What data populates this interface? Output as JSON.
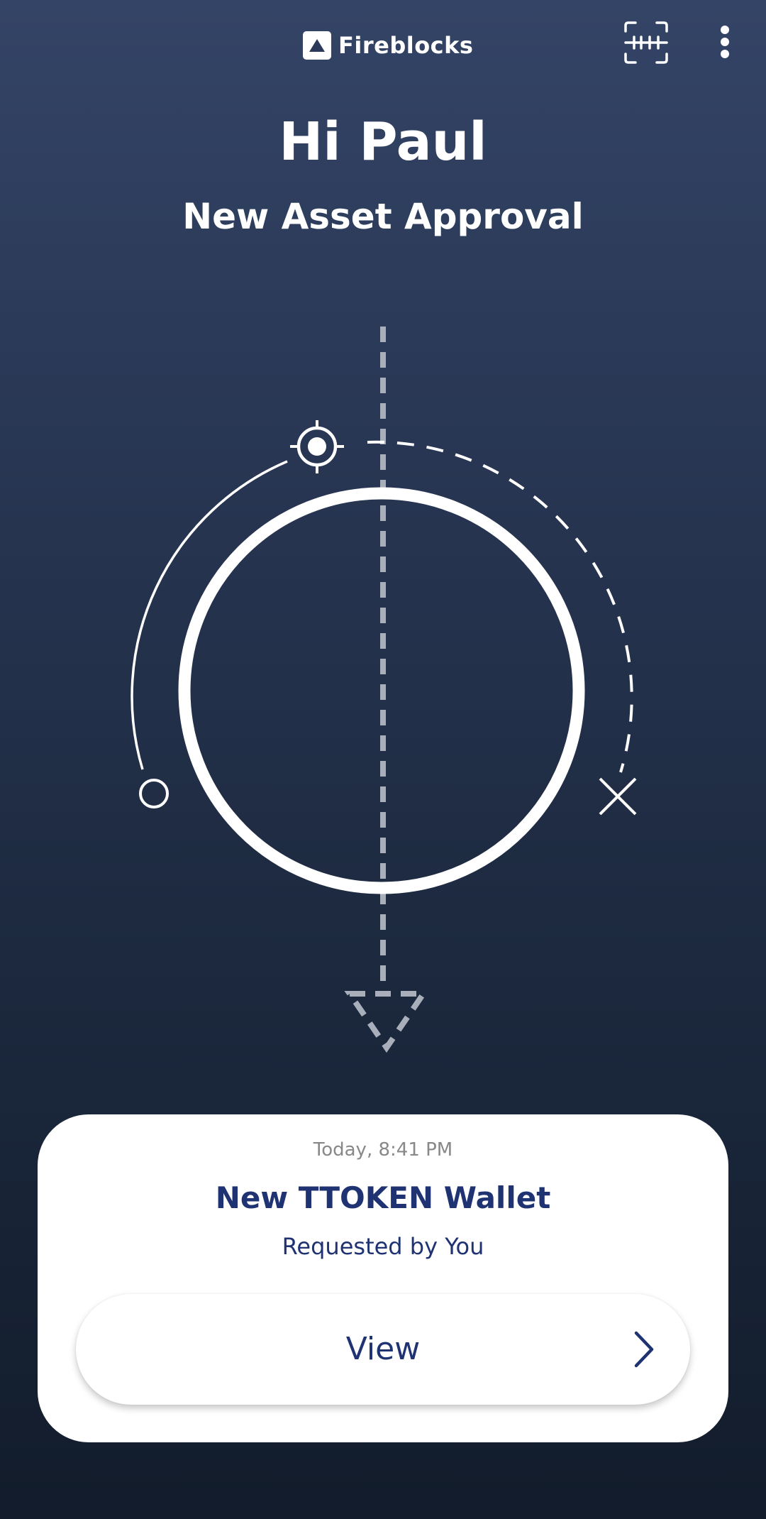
{
  "header": {
    "brand_name": "Fireblocks",
    "logo_icon": "fireblocks-logo-icon",
    "scan_icon": "qr-scan-icon",
    "menu_icon": "more-vertical-icon"
  },
  "greeting": "Hi Paul",
  "subtitle": "New Asset Approval",
  "illustration": {
    "icons": [
      "target-icon",
      "circle-icon",
      "close-x-icon",
      "triangle-down-icon"
    ]
  },
  "request_card": {
    "timestamp": "Today, 8:41 PM",
    "title": "New TTOKEN Wallet",
    "requested_by": "Requested by You",
    "view_button_label": "View",
    "view_button_icon": "chevron-right-icon"
  },
  "colors": {
    "background_top": "#344466",
    "background_bottom": "#121c2b",
    "accent_text": "#1f3272",
    "card_background": "#ffffff",
    "muted_text": "#888888"
  }
}
